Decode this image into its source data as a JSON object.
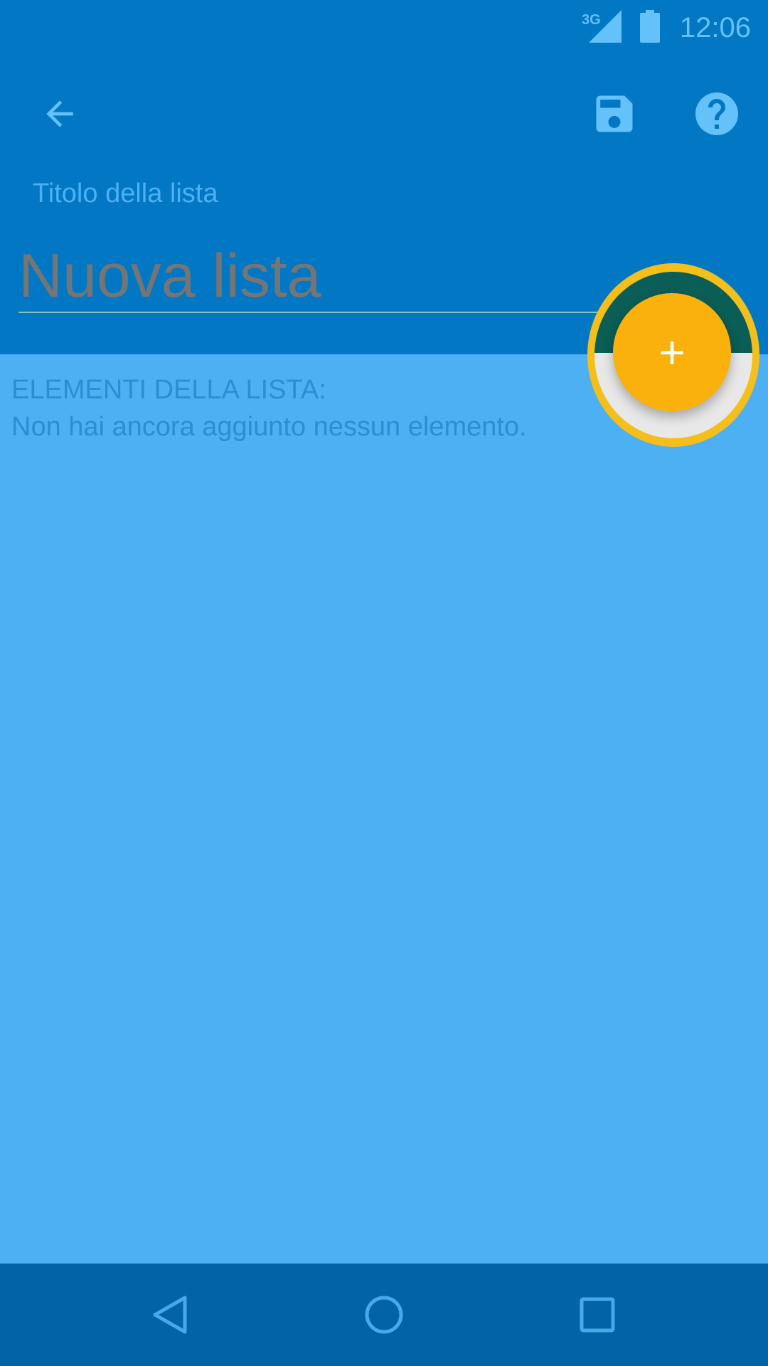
{
  "status_bar": {
    "network_label": "3G",
    "network_icon": "signal-3g-icon",
    "battery_icon": "battery-icon",
    "time": "12:06"
  },
  "app_bar": {
    "back_icon": "arrow-back-icon",
    "save_icon": "save-floppy-icon",
    "help_icon": "help-circle-icon",
    "title_label": "Titolo della lista",
    "title_placeholder": "Nuova lista"
  },
  "content": {
    "section_label": "ELEMENTI DELLA LISTA:",
    "empty_text": "Non hai ancora aggiunto nessun elemento."
  },
  "fab": {
    "label": "+",
    "icon": "add-icon"
  },
  "nav_bar": {
    "back_icon": "nav-back-icon",
    "home_icon": "nav-home-icon",
    "recents_icon": "nav-recents-icon"
  },
  "colors": {
    "primary": "#0277c4",
    "background": "#4db0f2",
    "accent": "#fbb10c",
    "highlight_ring": "#f5bf1b",
    "nav_bar": "#0263a6"
  }
}
